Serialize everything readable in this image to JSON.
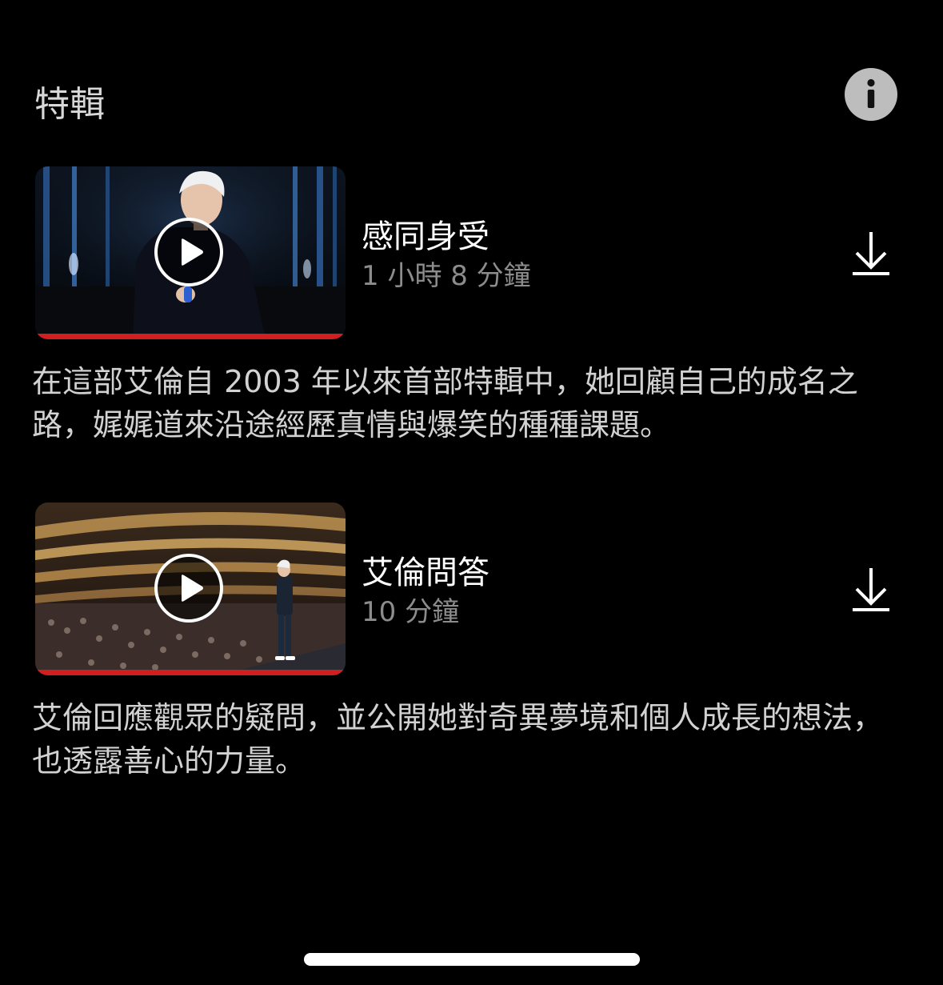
{
  "section": {
    "title": "特輯",
    "info_icon": "info-icon"
  },
  "episodes": [
    {
      "title": "感同身受",
      "duration": "1 小時 8 分鐘",
      "description": "在這部艾倫自 2003 年以來首部特輯中，她回顧自己的成名之路，娓娓道來沿途經歷真情與爆笑的種種課題。",
      "progress": 1.0,
      "thumbnail": "performer on stage with microphone",
      "play_icon": "play-icon",
      "download_icon": "download-icon"
    },
    {
      "title": "艾倫問答",
      "duration": "10 分鐘",
      "description": "艾倫回應觀眾的疑問，並公開她對奇異夢境和個人成長的想法，也透露善心的力量。",
      "progress": 1.0,
      "thumbnail": "performer on stage facing theater audience",
      "play_icon": "play-icon",
      "download_icon": "download-icon"
    }
  ],
  "colors": {
    "background": "#000000",
    "progress": "#d11f1f",
    "secondary_text": "#8c8c8c"
  }
}
